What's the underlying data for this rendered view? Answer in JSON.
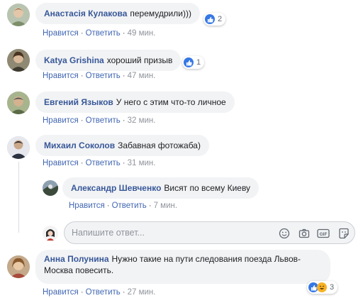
{
  "comments": [
    {
      "author": "Анастасія Кулакова",
      "text": "перемудрили)))",
      "like_label": "Нравится",
      "reply_label": "Ответить",
      "time": "49 мин.",
      "reactions": "2"
    },
    {
      "author": "Katya Grishina",
      "text": "хороший призыв",
      "like_label": "Нравится",
      "reply_label": "Ответить",
      "time": "47 мин.",
      "reactions": "1"
    },
    {
      "author": "Евгений Языков",
      "text": "У него с этим что-то личное",
      "like_label": "Нравится",
      "reply_label": "Ответить",
      "time": "32 мин."
    },
    {
      "author": "Михаил Соколов",
      "text": "Забавная фотожаба)",
      "like_label": "Нравится",
      "reply_label": "Ответить",
      "time": "31 мин."
    },
    {
      "author": "Анна Полунина",
      "text": "Нужно такие на пути следования поезда Львов-Москва повесить.",
      "like_label": "Нравится",
      "reply_label": "Ответить",
      "time": "27 мин.",
      "reactions": "3"
    }
  ],
  "reply": {
    "author": "Александр Шевченко",
    "text": "Висят по всему Киеву",
    "like_label": "Нравится",
    "reply_label": "Ответить",
    "time": "7 мин."
  },
  "reply_input": {
    "placeholder": "Напишите ответ..."
  },
  "separator": "·",
  "icons": [
    "like-icon",
    "haha-icon",
    "emoji-icon",
    "camera-icon",
    "gif-icon",
    "sticker-icon"
  ],
  "colors": {
    "link": "#385898",
    "action": "#4267b2",
    "bubble": "#f2f3f5",
    "like": "#3578e5",
    "haha": "#f7b125"
  }
}
